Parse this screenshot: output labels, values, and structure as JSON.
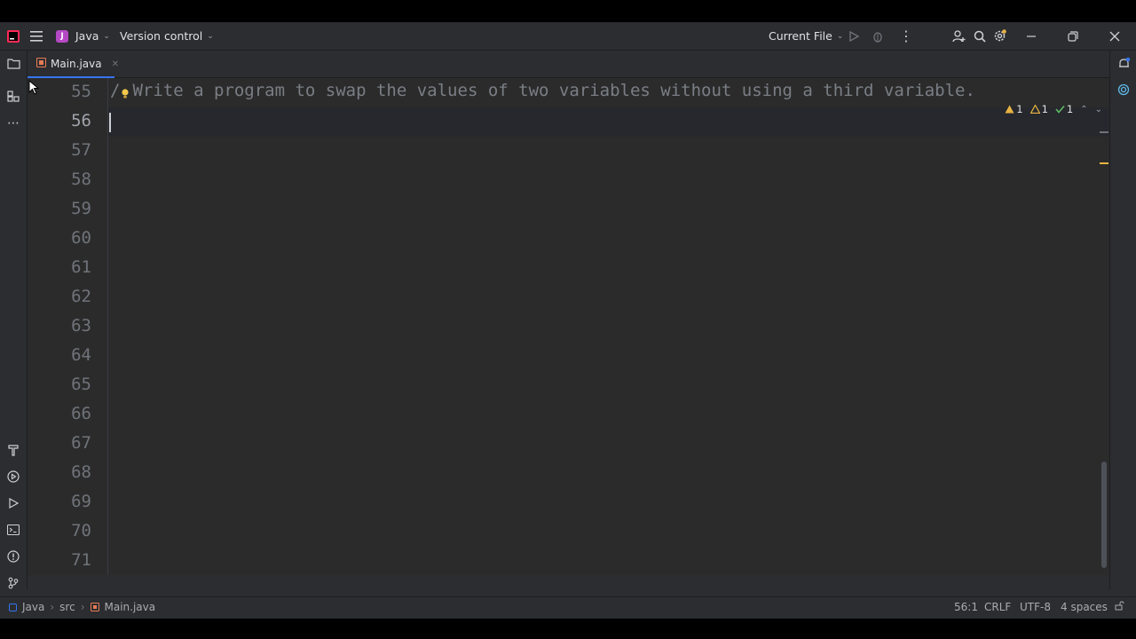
{
  "titlebar": {
    "project_initial": "J",
    "project_name": "Java",
    "vcs_label": "Version control",
    "run_config": "Current File"
  },
  "tabs": [
    {
      "label": "Main.java"
    }
  ],
  "editor": {
    "line_numbers": [
      "55",
      "56",
      "57",
      "58",
      "59",
      "60",
      "61",
      "62",
      "63",
      "64",
      "65",
      "66",
      "67",
      "68",
      "69",
      "70",
      "71"
    ],
    "current_line": "56",
    "code_line_55": "/Write a program to swap the values of two variables without using a third variable.",
    "code_line_55_prefix": "/",
    "inspections": {
      "warnings": "1",
      "weak_warnings": "1",
      "ok": "1"
    }
  },
  "statusbar": {
    "breadcrumb": [
      "Java",
      "src",
      "Main.java"
    ],
    "position": "56:1",
    "line_ending": "CRLF",
    "encoding": "UTF-8",
    "indent": "4 spaces"
  },
  "colors": {
    "accent": "#3574f0",
    "warning": "#e8b342",
    "ok": "#5fb865"
  }
}
